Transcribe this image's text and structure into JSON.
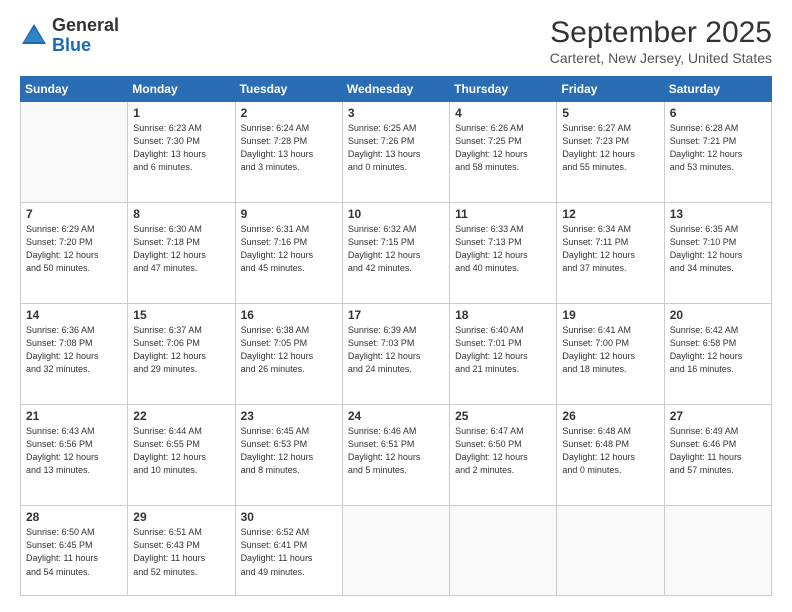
{
  "header": {
    "logo_general": "General",
    "logo_blue": "Blue",
    "month": "September 2025",
    "location": "Carteret, New Jersey, United States"
  },
  "weekdays": [
    "Sunday",
    "Monday",
    "Tuesday",
    "Wednesday",
    "Thursday",
    "Friday",
    "Saturday"
  ],
  "weeks": [
    [
      {
        "day": "",
        "info": ""
      },
      {
        "day": "1",
        "info": "Sunrise: 6:23 AM\nSunset: 7:30 PM\nDaylight: 13 hours\nand 6 minutes."
      },
      {
        "day": "2",
        "info": "Sunrise: 6:24 AM\nSunset: 7:28 PM\nDaylight: 13 hours\nand 3 minutes."
      },
      {
        "day": "3",
        "info": "Sunrise: 6:25 AM\nSunset: 7:26 PM\nDaylight: 13 hours\nand 0 minutes."
      },
      {
        "day": "4",
        "info": "Sunrise: 6:26 AM\nSunset: 7:25 PM\nDaylight: 12 hours\nand 58 minutes."
      },
      {
        "day": "5",
        "info": "Sunrise: 6:27 AM\nSunset: 7:23 PM\nDaylight: 12 hours\nand 55 minutes."
      },
      {
        "day": "6",
        "info": "Sunrise: 6:28 AM\nSunset: 7:21 PM\nDaylight: 12 hours\nand 53 minutes."
      }
    ],
    [
      {
        "day": "7",
        "info": "Sunrise: 6:29 AM\nSunset: 7:20 PM\nDaylight: 12 hours\nand 50 minutes."
      },
      {
        "day": "8",
        "info": "Sunrise: 6:30 AM\nSunset: 7:18 PM\nDaylight: 12 hours\nand 47 minutes."
      },
      {
        "day": "9",
        "info": "Sunrise: 6:31 AM\nSunset: 7:16 PM\nDaylight: 12 hours\nand 45 minutes."
      },
      {
        "day": "10",
        "info": "Sunrise: 6:32 AM\nSunset: 7:15 PM\nDaylight: 12 hours\nand 42 minutes."
      },
      {
        "day": "11",
        "info": "Sunrise: 6:33 AM\nSunset: 7:13 PM\nDaylight: 12 hours\nand 40 minutes."
      },
      {
        "day": "12",
        "info": "Sunrise: 6:34 AM\nSunset: 7:11 PM\nDaylight: 12 hours\nand 37 minutes."
      },
      {
        "day": "13",
        "info": "Sunrise: 6:35 AM\nSunset: 7:10 PM\nDaylight: 12 hours\nand 34 minutes."
      }
    ],
    [
      {
        "day": "14",
        "info": "Sunrise: 6:36 AM\nSunset: 7:08 PM\nDaylight: 12 hours\nand 32 minutes."
      },
      {
        "day": "15",
        "info": "Sunrise: 6:37 AM\nSunset: 7:06 PM\nDaylight: 12 hours\nand 29 minutes."
      },
      {
        "day": "16",
        "info": "Sunrise: 6:38 AM\nSunset: 7:05 PM\nDaylight: 12 hours\nand 26 minutes."
      },
      {
        "day": "17",
        "info": "Sunrise: 6:39 AM\nSunset: 7:03 PM\nDaylight: 12 hours\nand 24 minutes."
      },
      {
        "day": "18",
        "info": "Sunrise: 6:40 AM\nSunset: 7:01 PM\nDaylight: 12 hours\nand 21 minutes."
      },
      {
        "day": "19",
        "info": "Sunrise: 6:41 AM\nSunset: 7:00 PM\nDaylight: 12 hours\nand 18 minutes."
      },
      {
        "day": "20",
        "info": "Sunrise: 6:42 AM\nSunset: 6:58 PM\nDaylight: 12 hours\nand 16 minutes."
      }
    ],
    [
      {
        "day": "21",
        "info": "Sunrise: 6:43 AM\nSunset: 6:56 PM\nDaylight: 12 hours\nand 13 minutes."
      },
      {
        "day": "22",
        "info": "Sunrise: 6:44 AM\nSunset: 6:55 PM\nDaylight: 12 hours\nand 10 minutes."
      },
      {
        "day": "23",
        "info": "Sunrise: 6:45 AM\nSunset: 6:53 PM\nDaylight: 12 hours\nand 8 minutes."
      },
      {
        "day": "24",
        "info": "Sunrise: 6:46 AM\nSunset: 6:51 PM\nDaylight: 12 hours\nand 5 minutes."
      },
      {
        "day": "25",
        "info": "Sunrise: 6:47 AM\nSunset: 6:50 PM\nDaylight: 12 hours\nand 2 minutes."
      },
      {
        "day": "26",
        "info": "Sunrise: 6:48 AM\nSunset: 6:48 PM\nDaylight: 12 hours\nand 0 minutes."
      },
      {
        "day": "27",
        "info": "Sunrise: 6:49 AM\nSunset: 6:46 PM\nDaylight: 11 hours\nand 57 minutes."
      }
    ],
    [
      {
        "day": "28",
        "info": "Sunrise: 6:50 AM\nSunset: 6:45 PM\nDaylight: 11 hours\nand 54 minutes."
      },
      {
        "day": "29",
        "info": "Sunrise: 6:51 AM\nSunset: 6:43 PM\nDaylight: 11 hours\nand 52 minutes."
      },
      {
        "day": "30",
        "info": "Sunrise: 6:52 AM\nSunset: 6:41 PM\nDaylight: 11 hours\nand 49 minutes."
      },
      {
        "day": "",
        "info": ""
      },
      {
        "day": "",
        "info": ""
      },
      {
        "day": "",
        "info": ""
      },
      {
        "day": "",
        "info": ""
      }
    ]
  ]
}
